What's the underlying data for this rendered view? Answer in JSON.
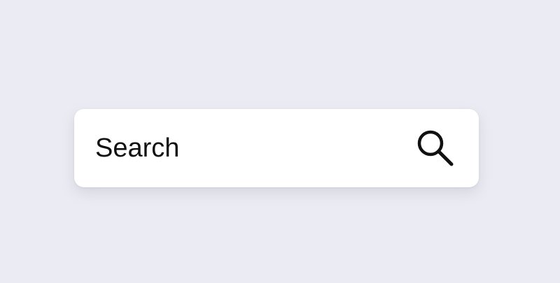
{
  "search": {
    "placeholder": "Search",
    "value": "",
    "button_icon": "search-icon"
  },
  "colors": {
    "background": "#ebebf3",
    "bar": "#ffffff",
    "text": "#111111",
    "icon": "#111111"
  }
}
